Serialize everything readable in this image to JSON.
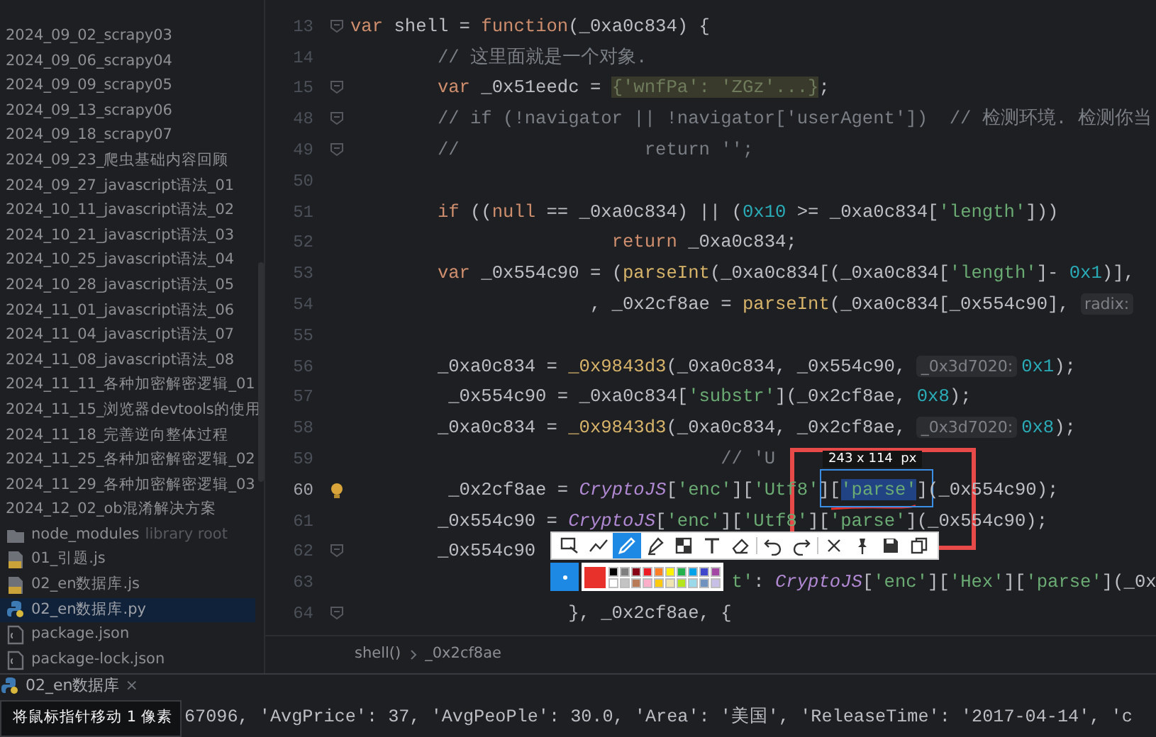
{
  "project_tree": {
    "items": [
      {
        "kind": "entry",
        "label": "2024_09_02_scrapy03",
        "selected": false
      },
      {
        "kind": "entry",
        "label": "2024_09_06_scrapy04",
        "selected": false
      },
      {
        "kind": "entry",
        "label": "2024_09_09_scrapy05",
        "selected": false
      },
      {
        "kind": "entry",
        "label": "2024_09_13_scrapy06",
        "selected": false
      },
      {
        "kind": "entry",
        "label": "2024_09_18_scrapy07",
        "selected": false
      },
      {
        "kind": "entry",
        "label": "2024_09_23_爬虫基础内容回顾",
        "selected": false
      },
      {
        "kind": "entry",
        "label": "2024_09_27_javascript语法_01",
        "selected": false
      },
      {
        "kind": "entry",
        "label": "2024_10_11_javascript语法_02",
        "selected": false
      },
      {
        "kind": "entry",
        "label": "2024_10_21_javascript语法_03",
        "selected": false
      },
      {
        "kind": "entry",
        "label": "2024_10_25_javascript语法_04",
        "selected": false
      },
      {
        "kind": "entry",
        "label": "2024_10_28_javascript语法_05",
        "selected": false
      },
      {
        "kind": "entry",
        "label": "2024_11_01_javascript语法_06",
        "selected": false
      },
      {
        "kind": "entry",
        "label": "2024_11_04_javascript语法_07",
        "selected": false
      },
      {
        "kind": "entry",
        "label": "2024_11_08_javascript语法_08",
        "selected": false
      },
      {
        "kind": "entry",
        "label": "2024_11_11_各种加密解密逻辑_01",
        "selected": false
      },
      {
        "kind": "entry",
        "label": "2024_11_15_浏览器devtools的使用",
        "selected": false
      },
      {
        "kind": "entry",
        "label": "2024_11_18_完善逆向整体过程",
        "selected": false
      },
      {
        "kind": "entry",
        "label": "2024_11_25_各种加密解密逻辑_02",
        "selected": false
      },
      {
        "kind": "entry",
        "label": "2024_11_29_各种加密解密逻辑_03",
        "selected": false
      },
      {
        "kind": "entry",
        "label": "2024_12_02_ob混淆解决方案",
        "selected": false
      },
      {
        "kind": "folder",
        "label": "node_modules",
        "note": "library root",
        "selected": false
      },
      {
        "kind": "js",
        "label": "01_引题.js",
        "selected": false
      },
      {
        "kind": "js",
        "label": "02_en数据库.js",
        "selected": false
      },
      {
        "kind": "py",
        "label": "02_en数据库.py",
        "selected": true
      },
      {
        "kind": "json",
        "label": "package.json",
        "selected": false
      },
      {
        "kind": "json",
        "label": "package-lock.json",
        "selected": false
      }
    ]
  },
  "editor": {
    "lines": [
      {
        "number": "13",
        "kind": "fold",
        "tokens": [
          {
            "kind": "kw",
            "text": "var"
          },
          {
            "kind": "id",
            "text": " shell = "
          },
          {
            "kind": "kw",
            "text": "function"
          },
          {
            "kind": "id",
            "text": "(_0xa0c834) {"
          }
        ]
      },
      {
        "number": "14",
        "kind": "plain",
        "tokens": [
          {
            "kind": "com",
            "text": "        // 这里面就是一个对象."
          }
        ]
      },
      {
        "number": "15",
        "kind": "fold",
        "tokens": [
          {
            "kind": "kw",
            "text": "        var"
          },
          {
            "kind": "id",
            "text": " _0x51eedc = "
          },
          {
            "kind": "folded",
            "text": "{'wnfPa': 'ZGz'...}"
          },
          {
            "kind": "id",
            "text": ";"
          }
        ]
      },
      {
        "number": "48",
        "kind": "fold",
        "tokens": [
          {
            "kind": "com",
            "text": "        // if (!navigator || !navigator['userAgent'])  // 检测环境. 检测你当"
          }
        ]
      },
      {
        "number": "49",
        "kind": "fold",
        "tokens": [
          {
            "kind": "com",
            "text": "        //                 return '';"
          }
        ]
      },
      {
        "number": "50",
        "kind": "plain"
      },
      {
        "number": "51",
        "kind": "plain",
        "tokens": [
          {
            "kind": "kw",
            "text": "        if"
          },
          {
            "kind": "id",
            "text": " (("
          },
          {
            "kind": "kw",
            "text": "null"
          },
          {
            "kind": "id",
            "text": " == _0xa0c834) || ("
          },
          {
            "kind": "num",
            "text": "0x10"
          },
          {
            "kind": "id",
            "text": " >= _0xa0c834["
          },
          {
            "kind": "str",
            "text": "'length'"
          },
          {
            "kind": "id",
            "text": "]))"
          }
        ]
      },
      {
        "number": "52",
        "kind": "plain",
        "tokens": [
          {
            "kind": "kw",
            "text": "                        return"
          },
          {
            "kind": "id",
            "text": " _0xa0c834;"
          }
        ]
      },
      {
        "number": "53",
        "kind": "plain",
        "tokens": [
          {
            "kind": "kw",
            "text": "        var"
          },
          {
            "kind": "id",
            "text": " _0x554c90 = ("
          },
          {
            "kind": "fn",
            "text": "parseInt"
          },
          {
            "kind": "id",
            "text": "(_0xa0c834[(_0xa0c834["
          },
          {
            "kind": "str",
            "text": "'length'"
          },
          {
            "kind": "id",
            "text": "]- "
          },
          {
            "kind": "num",
            "text": "0x1"
          },
          {
            "kind": "id",
            "text": ")],"
          }
        ]
      },
      {
        "number": "54",
        "kind": "plain",
        "tokens": [
          {
            "kind": "id",
            "text": "                      , _0x2cf8ae = "
          },
          {
            "kind": "fn",
            "text": "parseInt"
          },
          {
            "kind": "id",
            "text": "(_0xa0c834[_0x554c90], "
          },
          {
            "kind": "hint",
            "text": "radix:"
          }
        ]
      },
      {
        "number": "55",
        "kind": "plain"
      },
      {
        "number": "56",
        "kind": "plain",
        "tokens": [
          {
            "kind": "id",
            "text": "        _0xa0c834 = "
          },
          {
            "kind": "fn",
            "text": "_0x9843d3"
          },
          {
            "kind": "id",
            "text": "(_0xa0c834, _0x554c90, "
          },
          {
            "kind": "hint",
            "text": "_0x3d7020:"
          },
          {
            "kind": "num",
            "text": "0x1"
          },
          {
            "kind": "id",
            "text": ");"
          }
        ]
      },
      {
        "number": "57",
        "kind": "plain",
        "tokens": [
          {
            "kind": "id",
            "text": "         _0x554c90 = _0xa0c834["
          },
          {
            "kind": "str",
            "text": "'substr'"
          },
          {
            "kind": "id",
            "text": "](_0x2cf8ae, "
          },
          {
            "kind": "num",
            "text": "0x8"
          },
          {
            "kind": "id",
            "text": ");"
          }
        ]
      },
      {
        "number": "58",
        "kind": "plain",
        "tokens": [
          {
            "kind": "id",
            "text": "        _0xa0c834 = "
          },
          {
            "kind": "fn",
            "text": "_0x9843d3"
          },
          {
            "kind": "id",
            "text": "(_0xa0c834, _0x2cf8ae, "
          },
          {
            "kind": "hint",
            "text": "_0x3d7020:"
          },
          {
            "kind": "num",
            "text": "0x8"
          },
          {
            "kind": "id",
            "text": ");"
          }
        ]
      },
      {
        "number": "59",
        "kind": "plain",
        "tokens": [
          {
            "kind": "com",
            "text": "                                  // 'U"
          }
        ]
      },
      {
        "number": "60",
        "kind": "bulb",
        "tokens": [
          {
            "kind": "id",
            "text": "         _0x2cf8ae = "
          },
          {
            "kind": "cls",
            "text": "CryptoJS"
          },
          {
            "kind": "id",
            "text": "["
          },
          {
            "kind": "str",
            "text": "'enc'"
          },
          {
            "kind": "id",
            "text": "]["
          },
          {
            "kind": "str",
            "text": "'Utf8'"
          },
          {
            "kind": "id",
            "text": "]["
          },
          {
            "kind": "sel",
            "text": "'parse'"
          },
          {
            "kind": "id",
            "text": "](_0x554c90);"
          }
        ]
      },
      {
        "number": "61",
        "kind": "plain",
        "tokens": [
          {
            "kind": "id",
            "text": "        _0x554c90 = "
          },
          {
            "kind": "cls",
            "text": "CryptoJS"
          },
          {
            "kind": "id",
            "text": "["
          },
          {
            "kind": "str",
            "text": "'enc'"
          },
          {
            "kind": "id",
            "text": "]["
          },
          {
            "kind": "str",
            "text": "'Utf8'"
          },
          {
            "kind": "id",
            "text": "]["
          },
          {
            "kind": "str",
            "text": "'parse'"
          },
          {
            "kind": "id",
            "text": "](_0x554c90);"
          }
        ]
      },
      {
        "number": "62",
        "kind": "fold",
        "tokens": [
          {
            "kind": "id",
            "text": "        _0x554c90"
          }
        ]
      },
      {
        "number": "63",
        "kind": "plain",
        "tokens": [
          {
            "kind": "str",
            "text": "                                   t'"
          },
          {
            "kind": "id",
            "text": ": "
          },
          {
            "kind": "cls",
            "text": "CryptoJS"
          },
          {
            "kind": "id",
            "text": "["
          },
          {
            "kind": "str",
            "text": "'enc'"
          },
          {
            "kind": "id",
            "text": "]["
          },
          {
            "kind": "str",
            "text": "'Hex'"
          },
          {
            "kind": "id",
            "text": "]["
          },
          {
            "kind": "str",
            "text": "'parse'"
          },
          {
            "kind": "id",
            "text": "](_0x"
          }
        ]
      },
      {
        "number": "64",
        "kind": "fold",
        "tokens": [
          {
            "kind": "id",
            "text": "                    }, _0x2cf8ae, {"
          }
        ]
      }
    ],
    "breadcrumb": [
      "shell()",
      "_0x2cf8ae"
    ]
  },
  "run_panel": {
    "tab": {
      "label": "02_en数据库",
      "close": "×"
    },
    "output": "67096, 'AvgPrice': 37, 'AvgPeoPle': 30.0, 'Area': '美国', 'ReleaseTime': '2017-04-14', 'c"
  },
  "tooltip": "将鼠标指针移动 1 像素",
  "capture_tool": {
    "size_label": "243 x 114  px",
    "tools": [
      {
        "kind": "rect",
        "selected": false
      },
      {
        "kind": "line",
        "selected": false
      },
      {
        "kind": "pen",
        "selected": true
      },
      {
        "kind": "marker",
        "selected": false
      },
      {
        "kind": "mosaic",
        "selected": false
      },
      {
        "kind": "text",
        "selected": false
      },
      {
        "kind": "eraser",
        "selected": false
      },
      {
        "kind": "undo",
        "selected": false
      },
      {
        "kind": "redo",
        "selected": false
      },
      {
        "kind": "close",
        "selected": false
      },
      {
        "kind": "pin",
        "selected": false
      },
      {
        "kind": "save",
        "selected": false
      },
      {
        "kind": "copy",
        "selected": false
      }
    ],
    "current": {
      "color": "#e8312a"
    },
    "swatches": [
      {
        "color": "#000000"
      },
      {
        "color": "#7f7f7f"
      },
      {
        "color": "#880015"
      },
      {
        "color": "#ed1c24"
      },
      {
        "color": "#ff7f27"
      },
      {
        "color": "#fff200"
      },
      {
        "color": "#22b14c"
      },
      {
        "color": "#00a2e8"
      },
      {
        "color": "#3f48cc"
      },
      {
        "color": "#a349a4"
      },
      {
        "color": "#ffffff"
      },
      {
        "color": "#c3c3c3"
      },
      {
        "color": "#b97a57"
      },
      {
        "color": "#ffaec9"
      },
      {
        "color": "#ffc90e"
      },
      {
        "color": "#efe4b0"
      },
      {
        "color": "#b5e61d"
      },
      {
        "color": "#99d9ea"
      },
      {
        "color": "#7092be"
      },
      {
        "color": "#c8bfe7"
      }
    ]
  }
}
